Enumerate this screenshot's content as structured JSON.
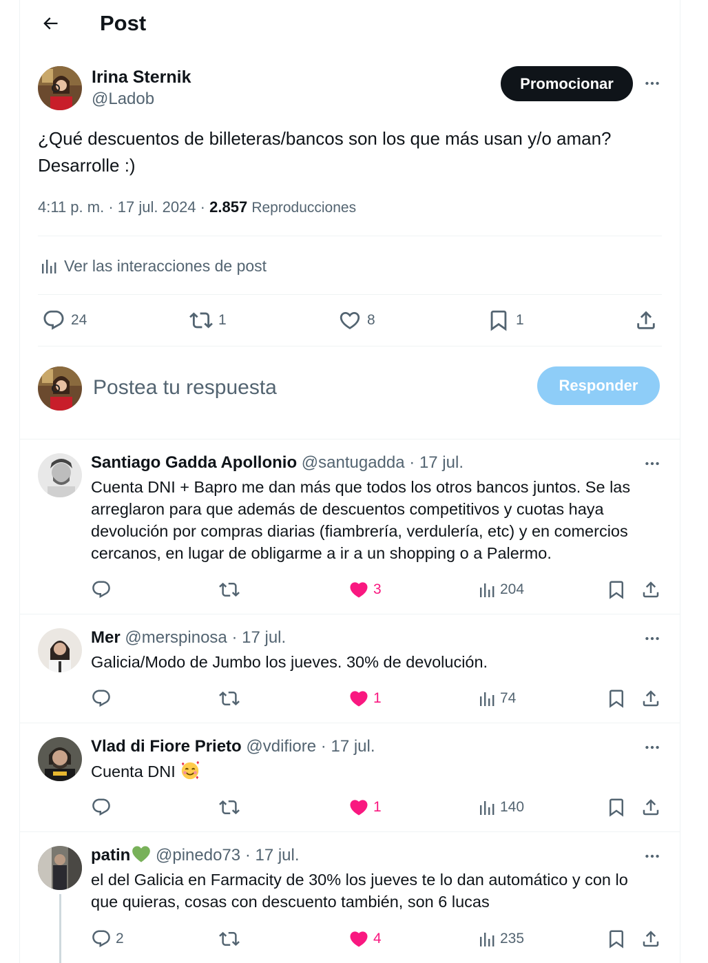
{
  "header": {
    "title": "Post"
  },
  "post": {
    "author_name": "Irina Sternik",
    "author_handle": "@Ladob",
    "promote_label": "Promocionar",
    "text_line1": "¿Qué descuentos de billeteras/bancos son los que más usan y/o aman?",
    "text_line2": "Desarrolle :)",
    "time": "4:11 p. m.",
    "date": "17 jul. 2024",
    "views_count": "2.857",
    "views_label": "Reproducciones",
    "interactions_label": "Ver las interacciones de post",
    "replies": "24",
    "reposts": "1",
    "likes": "8",
    "bookmarks": "1"
  },
  "compose": {
    "placeholder": "Postea tu respuesta",
    "reply_label": "Responder"
  },
  "replies": [
    {
      "name": "Santiago Gadda Apollonio",
      "handle": "@santugadda",
      "date": "17 jul.",
      "lines": [
        "Cuenta DNI + Bapro me dan más que todos los otros bancos juntos. Se las",
        "arreglaron para que además de descuentos competitivos y cuotas haya",
        "devolución por compras diarias (fiambrería, verdulería, etc) y en comercios",
        "cercanos, en lugar de obligarme a ir a un shopping o a Palermo."
      ],
      "replies": "",
      "likes": "3",
      "views": "204"
    },
    {
      "name": "Mer",
      "handle": "@merspinosa",
      "date": "17 jul.",
      "lines": [
        "Galicia/Modo de Jumbo los jueves. 30% de devolución."
      ],
      "replies": "",
      "likes": "1",
      "views": "74"
    },
    {
      "name": "Vlad di Fiore Prieto",
      "handle": "@vdifiore",
      "date": "17 jul.",
      "lines": [
        "Cuenta DNI"
      ],
      "emoji": "smiling-face-with-hearts",
      "replies": "",
      "likes": "1",
      "views": "140"
    },
    {
      "name": "patin",
      "name_emoji": "green-heart",
      "handle": "@pinedo73",
      "date": "17 jul.",
      "lines": [
        "el del Galicia en Farmacity de 30% los jueves te lo dan automático y con lo",
        "que quieras, cosas con descuento también, son 6 lucas"
      ],
      "replies": "2",
      "likes": "4",
      "views": "235"
    }
  ],
  "colors": {
    "text": "#0f1419",
    "secondary": "#536471",
    "like": "#f91880",
    "reply_button": "#8ecdf8",
    "divider": "#eff3f4"
  }
}
